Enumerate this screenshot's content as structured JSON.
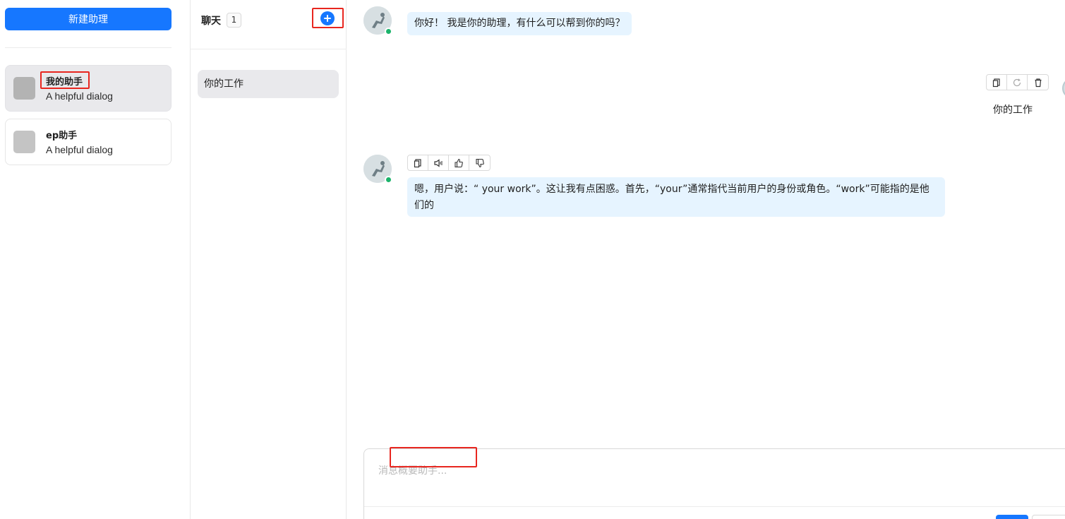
{
  "sidebar": {
    "new_assistant_label": "新建助理",
    "assistants": [
      {
        "name": "我的助手",
        "desc": "A helpful dialog",
        "avatar_color": "#b3b3b3",
        "active": true
      },
      {
        "name": "ep助手",
        "desc": "A helpful dialog",
        "avatar_color": "#c4c4c4",
        "active": false
      }
    ]
  },
  "chat_list": {
    "title": "聊天",
    "count": "1",
    "items": [
      {
        "label": "你的工作",
        "active": true
      }
    ],
    "add_icon": "plus-circle-icon"
  },
  "messages": {
    "greeting": "你好！ 我是你的助理，有什么可以帮到你的吗？",
    "user_message": "你的工作",
    "reply": "嗯，用户说：“ your work”。这让我有点困惑。首先，“your”通常指代当前用户的身份或角色。“work”可能指的是他们的"
  },
  "user_toolbar_icons": [
    "copy-icon",
    "refresh-icon",
    "trash-icon"
  ],
  "reply_toolbar_icons": [
    "copy-icon",
    "speaker-icon",
    "thumbs-up-icon",
    "thumbs-down-icon"
  ],
  "composer": {
    "placeholder": "消息概要助手..."
  },
  "colors": {
    "primary": "#1677ff",
    "bubble": "#e6f4ff",
    "online": "#1bb36b",
    "highlight": "#e8261f"
  }
}
